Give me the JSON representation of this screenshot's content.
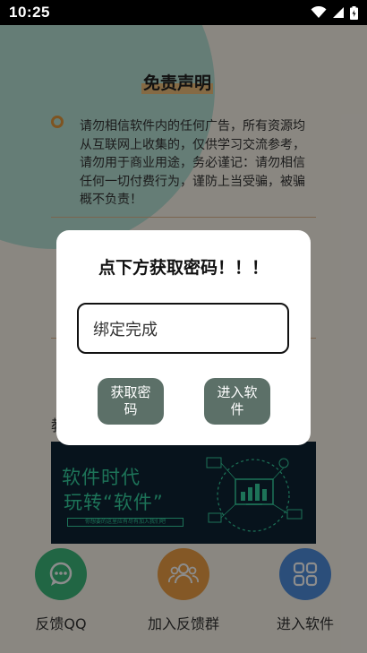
{
  "status_bar": {
    "time": "10:25"
  },
  "page": {
    "disclaimer_title": "免责声明",
    "notice_text": "请勿相信软件内的任何广告，所有资源均从互联网上收集的，仅供学习交流参考，请勿用于商业用途，务必谨记：请勿相信任何一切付费行为，谨防上当受骗，被骗概不负责！",
    "stray_char": "教",
    "banner": {
      "line1": "软件时代",
      "line2": "玩转“软件”",
      "sub": "你想要的这里应有尽有加入我们吧"
    }
  },
  "nav": {
    "items": [
      {
        "label": "反馈QQ",
        "icon": "chat-bubble-icon",
        "color": "#3dbb7c"
      },
      {
        "label": "加入反馈群",
        "icon": "group-icon",
        "color": "#f0a145"
      },
      {
        "label": "进入软件",
        "icon": "apps-grid-icon",
        "color": "#4f8fde"
      }
    ]
  },
  "dialog": {
    "title": "点下方获取密码！！！",
    "input_value": "绑定完成",
    "get_password_label": "获取密码",
    "enter_app_label": "进入软件"
  },
  "colors": {
    "accent_green": "#35d1a0",
    "button_gray": "#5c7068",
    "highlight_orange": "#f3c27c"
  }
}
